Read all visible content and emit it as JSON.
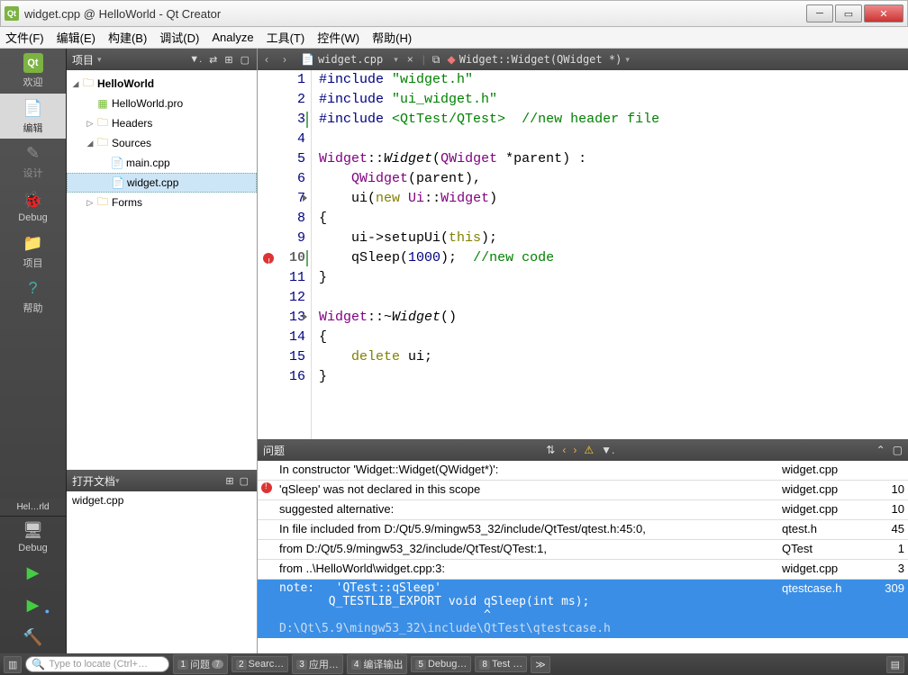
{
  "window": {
    "title": "widget.cpp @ HelloWorld - Qt Creator"
  },
  "menu": {
    "file": "文件(F)",
    "edit": "编辑(E)",
    "build": "构建(B)",
    "debug": "调试(D)",
    "analyze": "Analyze",
    "tools": "工具(T)",
    "widgets": "控件(W)",
    "help": "帮助(H)"
  },
  "leftnav": {
    "welcome": "欢迎",
    "edit": "编辑",
    "design": "设计",
    "debug": "Debug",
    "projects": "项目",
    "help": "帮助",
    "target_label": "Hel…rld",
    "debug2": "Debug"
  },
  "project_pane": {
    "title": "项目",
    "tree": {
      "root": "HelloWorld",
      "pro": "HelloWorld.pro",
      "headers": "Headers",
      "sources": "Sources",
      "main": "main.cpp",
      "widget": "widget.cpp",
      "forms": "Forms"
    }
  },
  "opendocs": {
    "title": "打开文档",
    "items": [
      "widget.cpp"
    ]
  },
  "editor": {
    "file": "widget.cpp",
    "symbol": "Widget::Widget(QWidget *)",
    "lines": [
      {
        "n": 1,
        "html": "<span class='pp'>#include</span> <span class='str'>\"widget.h\"</span>"
      },
      {
        "n": 2,
        "html": "<span class='pp'>#include</span> <span class='str'>\"ui_widget.h\"</span>"
      },
      {
        "n": 3,
        "ibar": true,
        "html": "<span class='pp'>#include</span> <span class='str'>&lt;QtTest/QTest&gt;</span>  <span class='cmt'>//new header file</span>"
      },
      {
        "n": 4,
        "html": ""
      },
      {
        "n": 5,
        "html": "<span class='type'>Widget</span>::<span class='fn'>Widget</span>(<span class='type'>QWidget</span> *parent) :"
      },
      {
        "n": 6,
        "html": "    <span class='type'>QWidget</span>(parent),"
      },
      {
        "n": 7,
        "fold": true,
        "html": "    ui(<span class='kw'>new</span> <span class='type'>Ui</span>::<span class='type'>Widget</span>)"
      },
      {
        "n": 8,
        "html": "{"
      },
      {
        "n": 9,
        "html": "    ui-&gt;setupUi(<span class='kw'>this</span>);"
      },
      {
        "n": 10,
        "err": true,
        "ibar": true,
        "bold": true,
        "html": "    qSleep(<span class='num'>1000</span>);  <span class='cmt'>//new code</span>"
      },
      {
        "n": 11,
        "html": "}"
      },
      {
        "n": 12,
        "html": ""
      },
      {
        "n": 13,
        "fold": true,
        "html": "<span class='type'>Widget</span>::~<span class='fn' style='font-style:italic'>Widget</span>()"
      },
      {
        "n": 14,
        "html": "{"
      },
      {
        "n": 15,
        "html": "    <span class='kw'>delete</span> ui;"
      },
      {
        "n": 16,
        "html": "}"
      }
    ]
  },
  "issues": {
    "title": "问题",
    "rows": [
      {
        "icon": "",
        "text": "In constructor 'Widget::Widget(QWidget*)':",
        "file": "widget.cpp",
        "line": ""
      },
      {
        "icon": "err",
        "text": "'qSleep' was not declared in this scope",
        "file": "widget.cpp",
        "line": "10"
      },
      {
        "icon": "",
        "text": "suggested alternative:",
        "file": "widget.cpp",
        "line": "10"
      },
      {
        "icon": "",
        "text": "In file included from D:/Qt/5.9/mingw53_32/include/QtTest/qtest.h:45:0,",
        "file": "qtest.h",
        "line": "45"
      },
      {
        "icon": "",
        "text": "from D:/Qt/5.9/mingw53_32/include/QtTest/QTest:1,",
        "file": "QTest",
        "line": "1"
      },
      {
        "icon": "",
        "text": "from ..\\HelloWorld\\widget.cpp:3:",
        "file": "widget.cpp",
        "line": "3"
      }
    ],
    "selected": {
      "text1": "note:   'QTest::qSleep'",
      "text2": "       Q_TESTLIB_EXPORT void qSleep(int ms);",
      "text3": "                             ^",
      "text4": "D:\\Qt\\5.9\\mingw53_32\\include\\QtTest\\qtestcase.h",
      "file": "qtestcase.h",
      "line": "309"
    }
  },
  "statusbar": {
    "search_placeholder": "Type to locate (Ctrl+…",
    "b1": "问题",
    "b1_badge": "7",
    "b2": "Searc…",
    "b3": "应用…",
    "b4": "编译输出",
    "b5": "Debug…",
    "b8": "Test …"
  }
}
